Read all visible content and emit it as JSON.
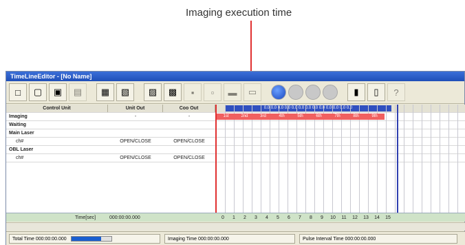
{
  "callouts": {
    "top": "Imaging execution time"
  },
  "window": {
    "title": "TimeLineEditor - [No Name]"
  },
  "grid": {
    "headers": [
      "Control Unit",
      "Unit Out",
      "Coo Out"
    ],
    "rows": [
      {
        "label": "Imaging",
        "unit": "-",
        "coo": "-"
      },
      {
        "label": "Waiting",
        "unit": "",
        "coo": ""
      },
      {
        "label": "Main Laser",
        "unit": "",
        "coo": ""
      },
      {
        "label": "ch#",
        "unit": "OPEN/CLOSE",
        "coo": "OPEN/CLOSE"
      },
      {
        "label": "OBL Laser",
        "unit": "",
        "coo": ""
      },
      {
        "label": "ch#",
        "unit": "OPEN/CLOSE",
        "coo": "OPEN/CLOSE"
      }
    ],
    "timeline_header": "0.0 0.0 0.0 0.0 0.0 0.0 0.0 0.0 0.0 0.0 0.0 0.0 0.0",
    "imaging_ticks": [
      "1st",
      "2nd",
      "3rd",
      "4th",
      "5th",
      "6th",
      "7th",
      "8th",
      "9th"
    ],
    "bottom_label": "Time[sec]",
    "bottom_value": "000:00:00.000",
    "bottom_numbers": [
      "0",
      "1",
      "2",
      "3",
      "4",
      "5",
      "6",
      "7",
      "8",
      "9",
      "10",
      "11",
      "12",
      "13",
      "14",
      "15"
    ]
  },
  "status": {
    "total_label": "Total Time",
    "total_value": "000:00:00.000",
    "total_progress": 0.75,
    "imaging_label": "Imaging Time",
    "imaging_value": "000:00:00.000",
    "pulse_label": "Pulse Interval Time",
    "pulse_value": "000:00:00.000"
  },
  "colors": {
    "imaging_bar": "#f06060",
    "timeline_marker": "#e03030",
    "cursor_line": "#3040b0"
  }
}
